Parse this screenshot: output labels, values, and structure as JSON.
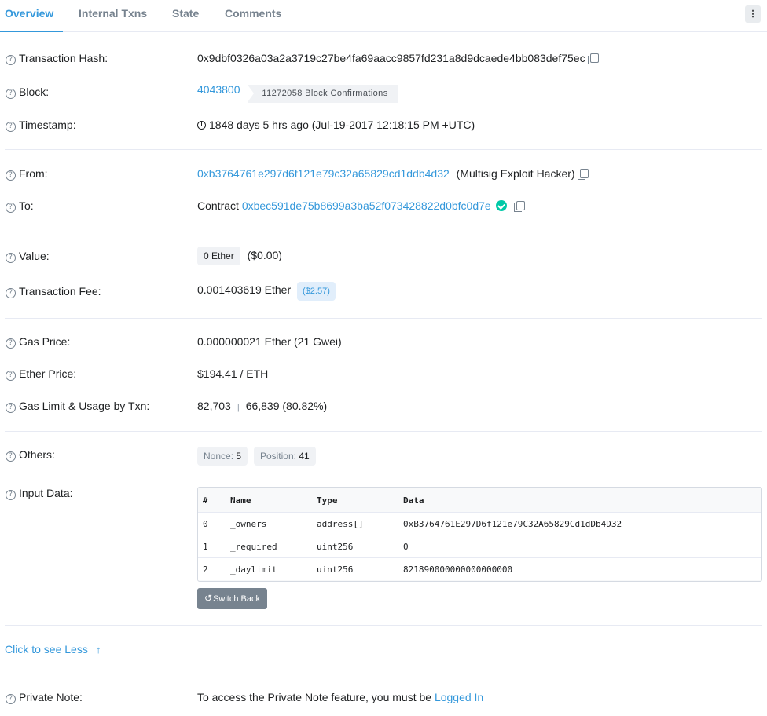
{
  "tabs": [
    "Overview",
    "Internal Txns",
    "State",
    "Comments"
  ],
  "more_icon": "⋮",
  "help_glyph": "?",
  "tx": {
    "hash_label": "Transaction Hash:",
    "hash": "0x9dbf0326a03a2a3719c27be4fa69aacc9857fd231a8d9dcaede4bb083def75ec",
    "block_label": "Block:",
    "block": "4043800",
    "confirmations": "11272058 Block Confirmations",
    "timestamp_label": "Timestamp:",
    "timestamp": "1848 days 5 hrs ago (Jul-19-2017 12:18:15 PM +UTC)",
    "from_label": "From:",
    "from": "0xb3764761e297d6f121e79c32a65829cd1ddb4d32",
    "from_tag": "(Multisig Exploit Hacker)",
    "to_label": "To:",
    "to_prefix": "Contract",
    "to": "0xbec591de75b8699a3ba52f073428822d0bfc0d7e",
    "value_label": "Value:",
    "value": "0 Ether",
    "value_usd": "($0.00)",
    "fee_label": "Transaction Fee:",
    "fee": "0.001403619 Ether",
    "fee_usd": "($2.57)",
    "gas_price_label": "Gas Price:",
    "gas_price": "0.000000021 Ether (21 Gwei)",
    "ether_price_label": "Ether Price:",
    "ether_price": "$194.41 / ETH",
    "gas_limit_label": "Gas Limit & Usage by Txn:",
    "gas_limit": "82,703",
    "gas_sep": "|",
    "gas_used": "66,839 (80.82%)",
    "others_label": "Others:",
    "nonce_label": "Nonce:",
    "nonce": "5",
    "position_label": "Position:",
    "position": "41",
    "input_label": "Input Data:",
    "private_note_label": "Private Note:",
    "private_note": "To access the Private Note feature, you must be",
    "logged_in": "Logged In"
  },
  "input_table": {
    "headers": [
      "#",
      "Name",
      "Type",
      "Data"
    ],
    "rows": [
      [
        "0",
        "_owners",
        "address[]",
        "0xB3764761E297D6f121e79C32A65829Cd1dDb4D32"
      ],
      [
        "1",
        "_required",
        "uint256",
        "0"
      ],
      [
        "2",
        "_daylimit",
        "uint256",
        "821890000000000000000"
      ]
    ]
  },
  "switch_back": "Switch Back",
  "undo_icon": "↺",
  "see_less": "Click to see Less",
  "arrow_up": "↑",
  "colors": {
    "link": "#3498db",
    "success": "#00c9a7",
    "muted": "#77838f"
  }
}
